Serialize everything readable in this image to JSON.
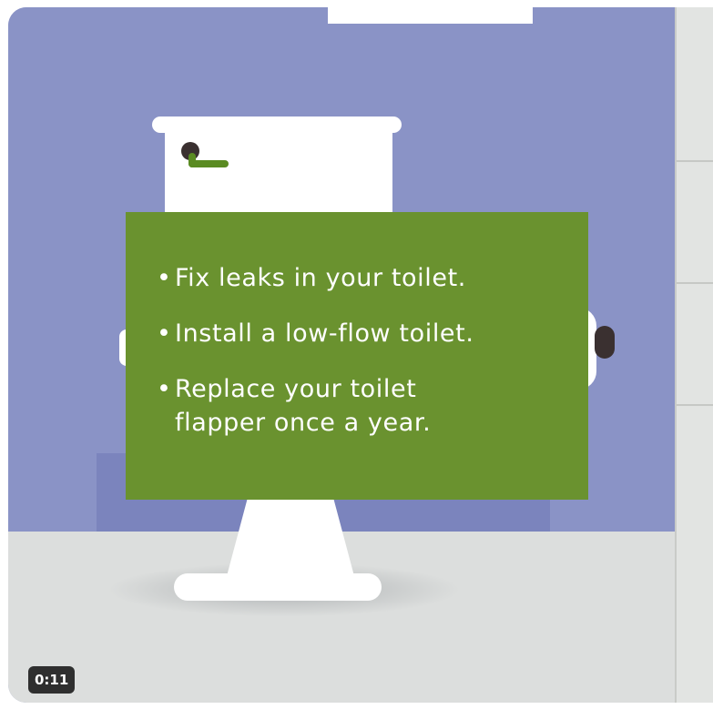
{
  "video": {
    "timestamp": "0:11",
    "tips": [
      {
        "bullet": "•",
        "text": "Fix leaks in your toilet."
      },
      {
        "bullet": "•",
        "text": "Install a low-flow toilet."
      },
      {
        "bullet": "•",
        "text": "Replace your toilet flapper once a year."
      }
    ]
  },
  "colors": {
    "wall": "#8a93c6",
    "panel": "#6a922f",
    "floor": "#dcdedd"
  }
}
